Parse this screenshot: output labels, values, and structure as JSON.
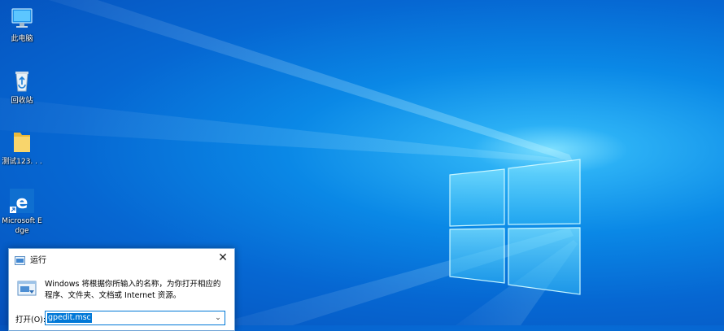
{
  "desktop": {
    "icons": [
      {
        "name": "this-pc",
        "label": "此电脑",
        "icon": "computer-icon"
      },
      {
        "name": "recycle-bin",
        "label": "回收站",
        "icon": "recycle-bin-icon"
      },
      {
        "name": "test-folder",
        "label": "测试123. . .",
        "icon": "folder-icon"
      },
      {
        "name": "microsoft-edge",
        "label": "Microsoft Edge",
        "icon": "edge-icon"
      }
    ]
  },
  "run_dialog": {
    "title": "运行",
    "description": "Windows 将根据你所输入的名称，为你打开相应的程序、文件夹、文档或 Internet 资源。",
    "open_label": "打开(O):",
    "open_value": "gpedit.msc",
    "close_glyph": "✕",
    "dropdown_glyph": "⌄"
  },
  "colors": {
    "accent": "#0078d7",
    "desktop_blue": "#0a88e6"
  }
}
